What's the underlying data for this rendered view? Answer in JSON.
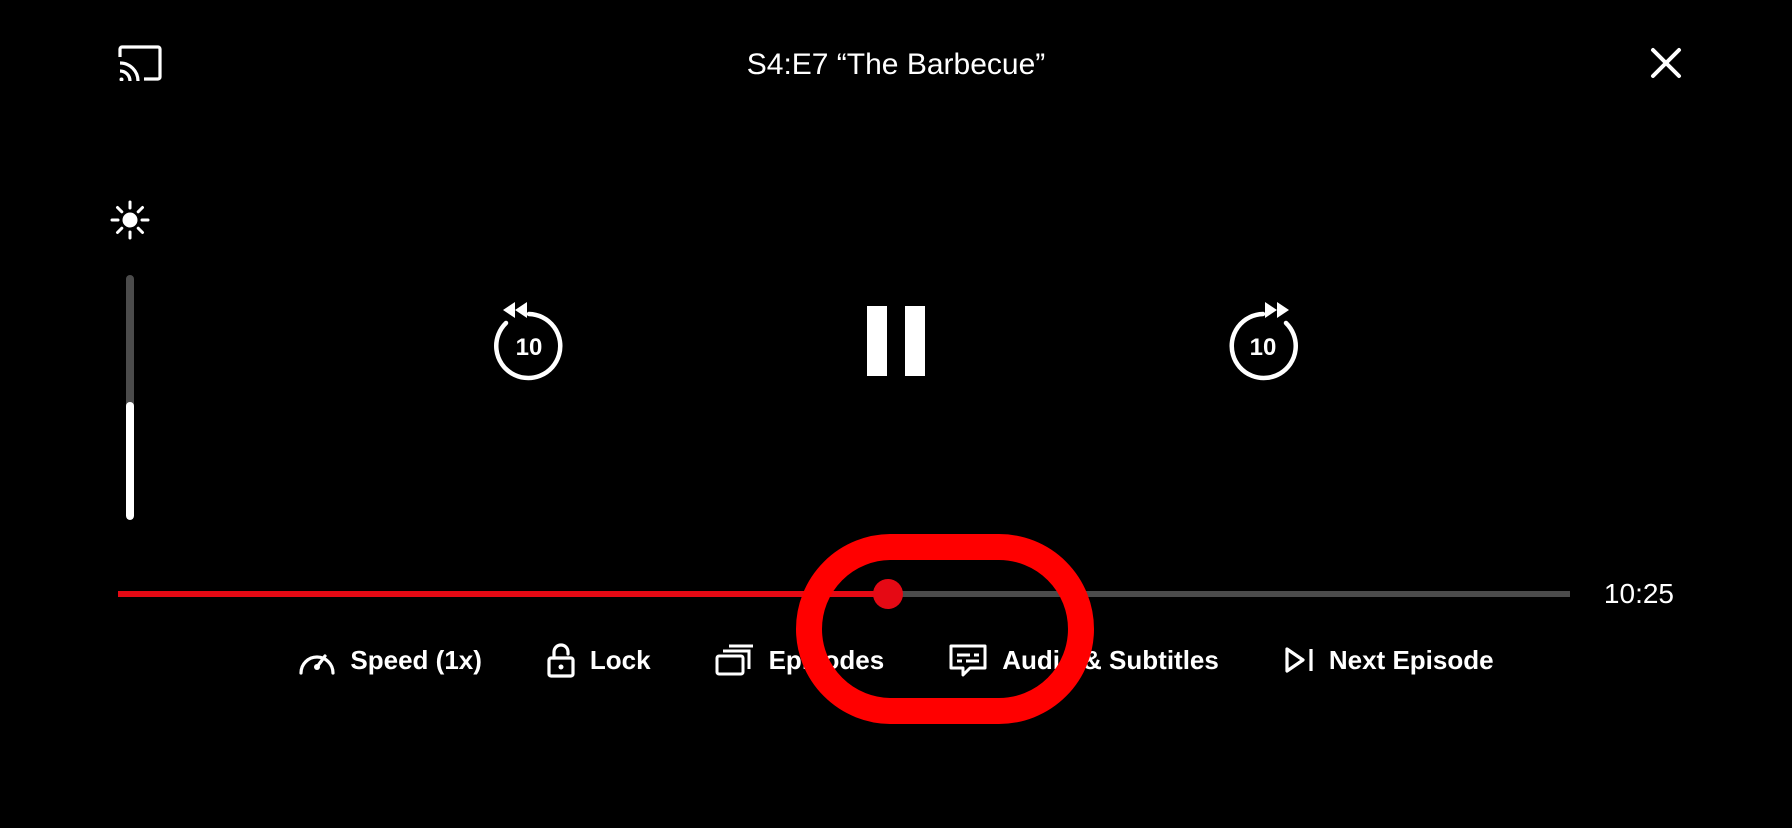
{
  "header": {
    "title": "S4:E7 “The Barbecue”"
  },
  "brightness": {
    "percent": 48
  },
  "seek": {
    "back_seconds": "10",
    "forward_seconds": "10"
  },
  "progress": {
    "percent": 53,
    "time_remaining": "10:25"
  },
  "bottom": {
    "speed_label": "Speed (1x)",
    "lock_label": "Lock",
    "episodes_label": "Episodes",
    "audio_subtitles_label": "Audio & Subtitles",
    "next_episode_label": "Next Episode"
  },
  "colors": {
    "accent": "#e50914",
    "annotation": "#ff0000"
  }
}
